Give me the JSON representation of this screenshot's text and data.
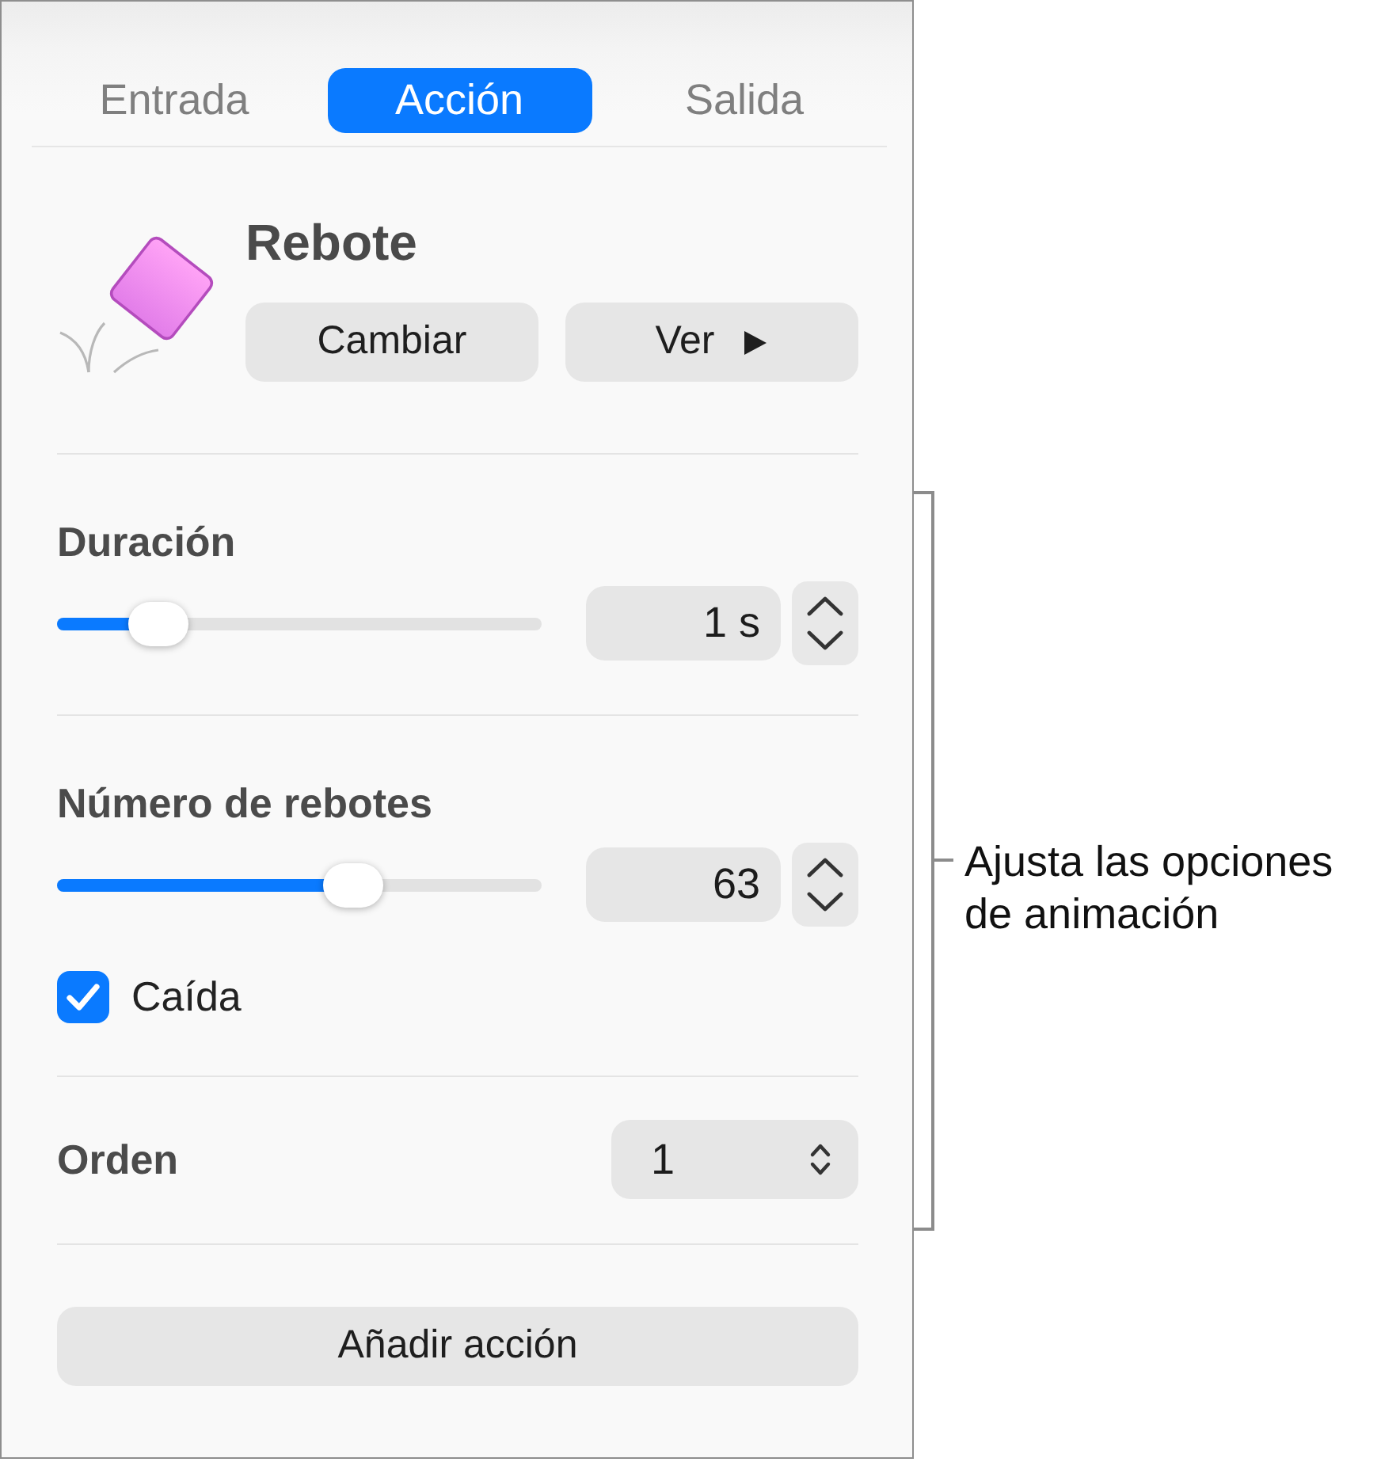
{
  "tabs": [
    {
      "label": "Entrada",
      "selected": false
    },
    {
      "label": "Acción",
      "selected": true
    },
    {
      "label": "Salida",
      "selected": false
    }
  ],
  "effect": {
    "title": "Rebote",
    "buttons": [
      {
        "label": "Cambiar",
        "kind": "text"
      },
      {
        "label": "Ver",
        "kind": "play"
      }
    ]
  },
  "sliders": [
    {
      "label": "Duración",
      "level": 0.21,
      "value": "1 s"
    },
    {
      "label": "Número de rebotes",
      "level": 0.61,
      "value": "63"
    }
  ],
  "checkbox": {
    "label": "Caída",
    "checked": true
  },
  "order": {
    "label": "Orden",
    "value": "1"
  },
  "add_button": {
    "label": "Añadir acción"
  },
  "callout": {
    "text": "Ajusta las opciones de animación"
  }
}
